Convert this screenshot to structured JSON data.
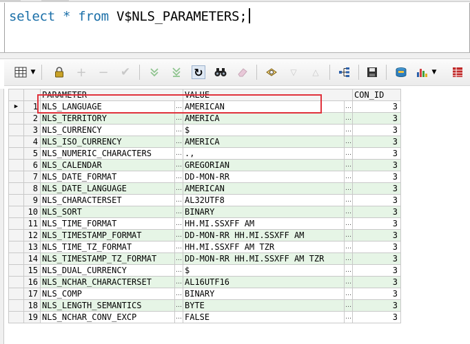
{
  "editor": {
    "keyword_select": "select",
    "star": "*",
    "keyword_from": "from",
    "table_name": "V$NLS_PARAMETERS;"
  },
  "grid": {
    "columns": [
      "PARAMETER",
      "VALUE",
      "CON_ID"
    ],
    "ellipsis": "…",
    "current_row_indicator": "▶",
    "rows": [
      {
        "n": "1",
        "parameter": "NLS_LANGUAGE",
        "value": "AMERICAN",
        "con_id": "3"
      },
      {
        "n": "2",
        "parameter": "NLS_TERRITORY",
        "value": "AMERICA",
        "con_id": "3"
      },
      {
        "n": "3",
        "parameter": "NLS_CURRENCY",
        "value": "$",
        "con_id": "3"
      },
      {
        "n": "4",
        "parameter": "NLS_ISO_CURRENCY",
        "value": "AMERICA",
        "con_id": "3"
      },
      {
        "n": "5",
        "parameter": "NLS_NUMERIC_CHARACTERS",
        "value": ".,",
        "con_id": "3"
      },
      {
        "n": "6",
        "parameter": "NLS_CALENDAR",
        "value": "GREGORIAN",
        "con_id": "3"
      },
      {
        "n": "7",
        "parameter": "NLS_DATE_FORMAT",
        "value": "DD-MON-RR",
        "con_id": "3"
      },
      {
        "n": "8",
        "parameter": "NLS_DATE_LANGUAGE",
        "value": "AMERICAN",
        "con_id": "3"
      },
      {
        "n": "9",
        "parameter": "NLS_CHARACTERSET",
        "value": "AL32UTF8",
        "con_id": "3"
      },
      {
        "n": "10",
        "parameter": "NLS_SORT",
        "value": "BINARY",
        "con_id": "3"
      },
      {
        "n": "11",
        "parameter": "NLS_TIME_FORMAT",
        "value": "HH.MI.SSXFF AM",
        "con_id": "3"
      },
      {
        "n": "12",
        "parameter": "NLS_TIMESTAMP_FORMAT",
        "value": "DD-MON-RR HH.MI.SSXFF AM",
        "con_id": "3"
      },
      {
        "n": "13",
        "parameter": "NLS_TIME_TZ_FORMAT",
        "value": "HH.MI.SSXFF AM TZR",
        "con_id": "3"
      },
      {
        "n": "14",
        "parameter": "NLS_TIMESTAMP_TZ_FORMAT",
        "value": "DD-MON-RR HH.MI.SSXFF AM TZR",
        "con_id": "3"
      },
      {
        "n": "15",
        "parameter": "NLS_DUAL_CURRENCY",
        "value": "$",
        "con_id": "3"
      },
      {
        "n": "16",
        "parameter": "NLS_NCHAR_CHARACTERSET",
        "value": "AL16UTF16",
        "con_id": "3"
      },
      {
        "n": "17",
        "parameter": "NLS_COMP",
        "value": "BINARY",
        "con_id": "3"
      },
      {
        "n": "18",
        "parameter": "NLS_LENGTH_SEMANTICS",
        "value": "BYTE",
        "con_id": "3"
      },
      {
        "n": "19",
        "parameter": "NLS_NCHAR_CONV_EXCP",
        "value": "FALSE",
        "con_id": "3"
      }
    ]
  },
  "colors": {
    "keyword": "#1a6fa8",
    "alt_row": "#e6f5e6",
    "highlight_box": "#e0303a"
  }
}
